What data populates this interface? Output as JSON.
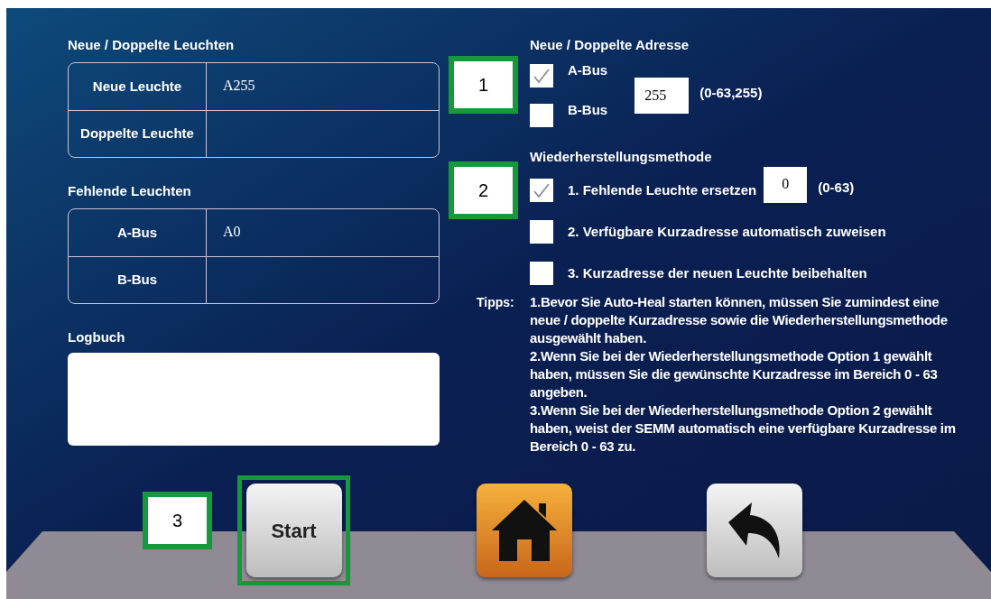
{
  "left": {
    "new_duplicate": {
      "title": "Neue / Doppelte Leuchten",
      "rows": [
        {
          "label": "Neue Leuchte",
          "value": "A255"
        },
        {
          "label": "Doppelte Leuchte"
        }
      ]
    },
    "missing": {
      "title": "Fehlende Leuchten",
      "rows": [
        {
          "label": "A-Bus",
          "value": "A0"
        },
        {
          "label": "B-Bus"
        }
      ]
    },
    "log": {
      "title": "Logbuch"
    }
  },
  "address": {
    "title": "Neue / Doppelte Adresse",
    "buses": [
      {
        "label": "A-Bus",
        "checked": true
      },
      {
        "label": "B-Bus",
        "checked": false
      }
    ],
    "value": "255",
    "range": "(0-63,255)"
  },
  "method": {
    "title": "Wiederherstellungsmethode",
    "options": [
      {
        "label": "1. Fehlende Leuchte ersetzen",
        "checked": true,
        "value": "0",
        "range": "(0-63)"
      },
      {
        "label": "2. Verfügbare Kurzadresse automatisch zuweisen",
        "checked": false
      },
      {
        "label": "3. Kurzadresse der neuen Leuchte beibehalten",
        "checked": false
      }
    ]
  },
  "tips": {
    "label": "Tipps:",
    "items": [
      "1.Bevor Sie Auto-Heal starten können, müssen Sie zumindest eine neue / doppelte Kurzadresse sowie die Wiederherstellungsmethode ausgewählt haben.",
      "2.Wenn Sie bei der Wiederherstellungsmethode Option 1 gewählt haben, müssen Sie die gewünschte Kurzadresse im Bereich 0 - 63 angeben.",
      "3.Wenn Sie bei der Wiederherstellungsmethode Option 2 gewählt haben, weist der SEMM automatisch eine verfügbare Kurzadresse im Bereich 0 - 63 zu."
    ]
  },
  "buttons": [
    {
      "kind": "start",
      "label": "Start",
      "highlighted": true
    },
    {
      "kind": "home",
      "highlighted": false
    },
    {
      "kind": "back",
      "highlighted": false
    }
  ],
  "callouts": [
    "1",
    "2",
    "3"
  ]
}
